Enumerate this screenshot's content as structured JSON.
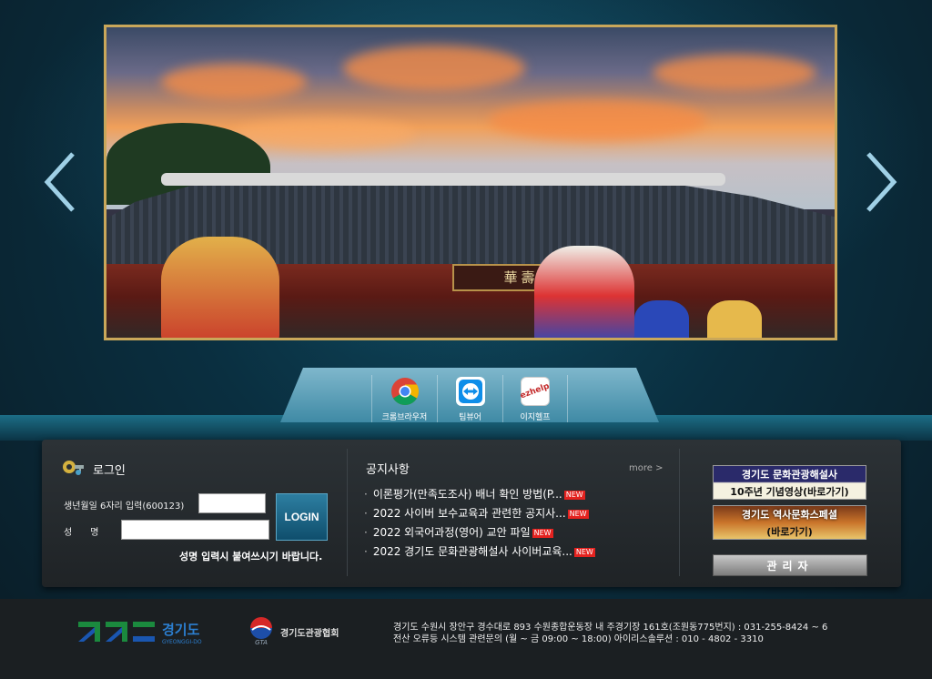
{
  "quick_links": [
    {
      "label": "크롬브라우저",
      "icon": "chrome-icon"
    },
    {
      "label": "팀뷰어",
      "icon": "teamviewer-icon"
    },
    {
      "label": "이지헬프",
      "icon": "ezhelp-icon",
      "icon_text": "ezhelp"
    }
  ],
  "slider": {
    "sign_text": "華壽堂"
  },
  "login": {
    "title": "로그인",
    "birth_label": "생년월일 6자리 입력(600123)",
    "birth_value": "",
    "name_label": "성　　명",
    "name_value": "",
    "button_label": "LOGIN",
    "note": "성명 입력시 붙여쓰시기 바랍니다."
  },
  "notice": {
    "title": "공지사항",
    "more": "more >",
    "items": [
      {
        "text": "이론평가(만족도조사) 배너 확인 방법(P...",
        "badge": "NEW"
      },
      {
        "text": "2022 사이버 보수교육과 관련한 공지사...",
        "badge": "NEW"
      },
      {
        "text": "2022 외국어과정(영어) 교안 파일",
        "badge": "NEW"
      },
      {
        "text": "2022 경기도 문화관광해설사 사이버교육...",
        "badge": "NEW"
      }
    ]
  },
  "banners": [
    {
      "line1": "경기도 문화관광해설사",
      "line2": "10주년 기념영상(바로가기)"
    },
    {
      "line1": "경기도 역사문화스페셜",
      "line2": "(바로가기)"
    }
  ],
  "admin_label": "관리자",
  "footer": {
    "gg_logo_kr": "경기도",
    "gg_logo_en": "GYEONGGI-DO",
    "gta_abbr": "GTA",
    "gta_name": "경기도관광협회",
    "address_line1": "경기도 수원시 장안구 경수대로 893 수원종합운동장 내 주경기장 161호(조원동775번지) : 031-255-8424 ~ 6",
    "address_line2": "전산 오류등 시스템 관련문의 (월 ~ 금 09:00 ~ 18:00) 아이리스솔루션 : 010 - 4802 - 3310"
  },
  "colors": {
    "accent": "#2d7ea1",
    "new_badge": "#e4221f",
    "frame_gold": "#c9a75a"
  }
}
